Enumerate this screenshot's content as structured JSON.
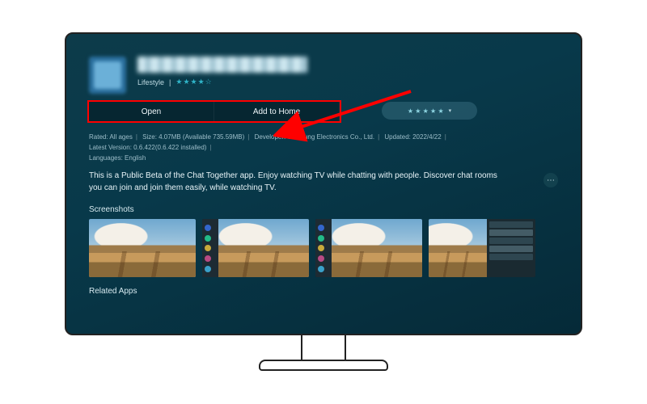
{
  "header": {
    "category": "Lifestyle",
    "rating_stars": "★★★★☆"
  },
  "actions": {
    "open_label": "Open",
    "add_home_label": "Add to Home",
    "rating_pill_stars": "★ ★ ★ ★ ★"
  },
  "meta": {
    "rated": "Rated: All ages",
    "size": "Size: 4.07MB (Available 735.59MB)",
    "developer": "Developer: Samsung Electronics Co., Ltd.",
    "updated": "Updated: 2022/4/22",
    "latest": "Latest Version: 0.6.422(0.6.422 installed)",
    "languages": "Languages: English"
  },
  "description": "This is a Public Beta of the Chat Together app. Enjoy watching TV while chatting with people. Discover chat rooms you can join and join them easily, while watching TV.",
  "sections": {
    "screenshots": "Screenshots",
    "related": "Related Apps"
  },
  "icons": {
    "more": "⋯",
    "chevron": "▾"
  }
}
